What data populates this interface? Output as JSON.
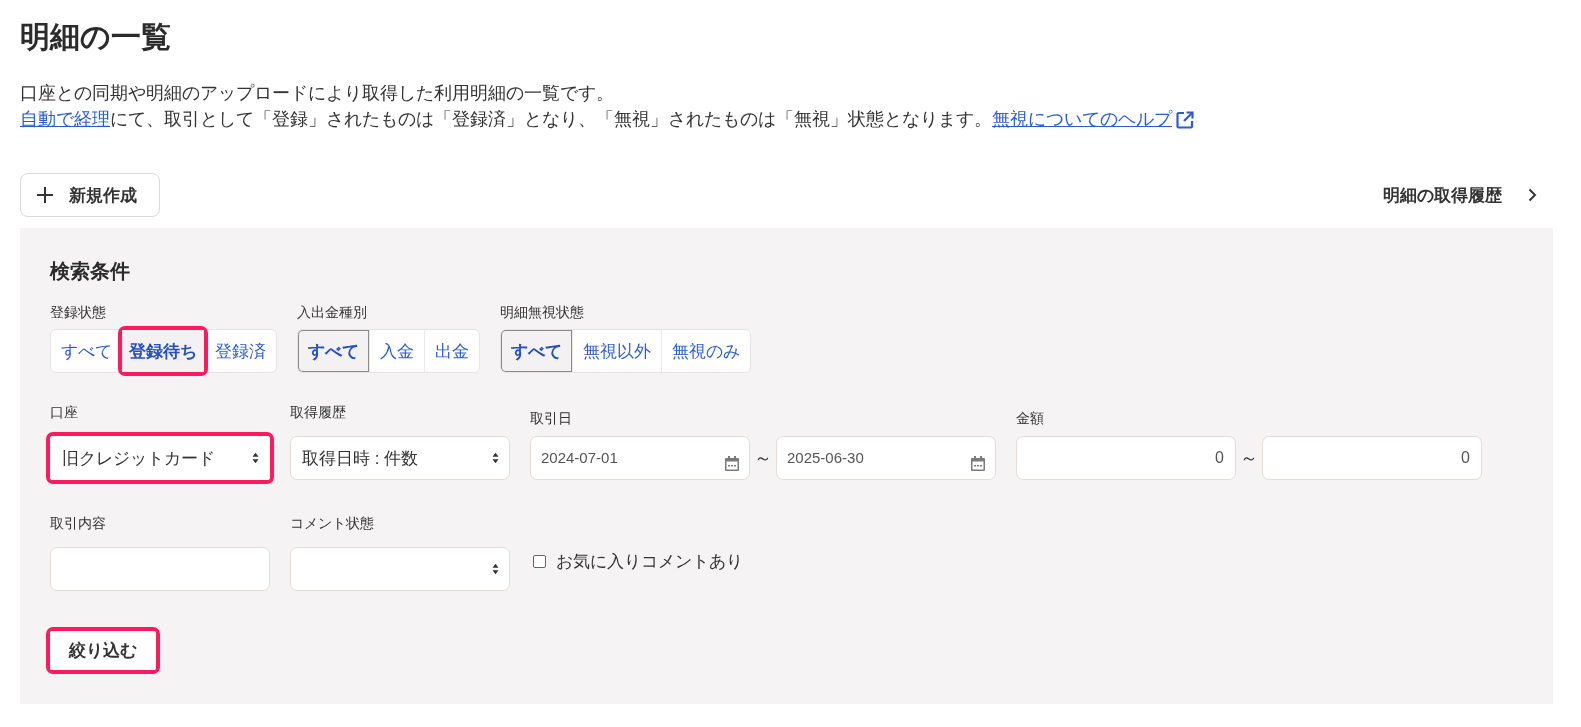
{
  "page": {
    "title": "明細の一覧",
    "description": [
      [
        {
          "kind": "text",
          "text": "口座との同期や明細のアップロードにより取得した利用明細の一覧です。"
        }
      ],
      [
        {
          "kind": "link",
          "text": "自動で経理",
          "external": false
        },
        {
          "kind": "text",
          "text": "にて、取引として「登録」されたものは「登録済」となり、「無視」されたものは「無視」状態となります。"
        },
        {
          "kind": "link",
          "text": "無視についてのヘルプ",
          "external": true
        }
      ]
    ]
  },
  "toolbar": {
    "new_button": "新規作成",
    "history_link": "明細の取得履歴"
  },
  "search": {
    "title": "検索条件",
    "toggle_groups": [
      {
        "label": "登録状態",
        "options": [
          {
            "label": "すべて",
            "selected": false,
            "highlighted": false
          },
          {
            "label": "登録待ち",
            "selected": true,
            "highlighted": true
          },
          {
            "label": "登録済",
            "selected": false,
            "highlighted": false
          }
        ]
      },
      {
        "label": "入出金種別",
        "options": [
          {
            "label": "すべて",
            "selected": true,
            "highlighted": false
          },
          {
            "label": "入金",
            "selected": false,
            "highlighted": false
          },
          {
            "label": "出金",
            "selected": false,
            "highlighted": false
          }
        ]
      },
      {
        "label": "明細無視状態",
        "options": [
          {
            "label": "すべて",
            "selected": true,
            "highlighted": false
          },
          {
            "label": "無視以外",
            "selected": false,
            "highlighted": false
          },
          {
            "label": "無視のみ",
            "selected": false,
            "highlighted": false
          }
        ]
      }
    ],
    "rows": [
      [
        {
          "kind": "select",
          "label": "口座",
          "value": "旧クレジットカード",
          "highlighted": true
        },
        {
          "kind": "select",
          "label": "取得履歴",
          "value": "取得日時 : 件数",
          "highlighted": false
        },
        {
          "kind": "date_range",
          "label": "取引日",
          "from": "2024-07-01",
          "separator": "～",
          "to": "2025-06-30",
          "highlighted": false
        },
        {
          "kind": "amount_range",
          "label": "金額",
          "from": "0",
          "separator": "～",
          "to": "0",
          "highlighted": false
        }
      ],
      [
        {
          "kind": "text",
          "label": "取引内容",
          "highlighted": false
        },
        {
          "kind": "select",
          "label": "コメント状態",
          "highlighted": false
        },
        {
          "kind": "checkbox",
          "label": "お気に入りコメントあり",
          "checked": false,
          "highlighted": false
        }
      ]
    ],
    "submit": {
      "label": "絞り込む",
      "highlighted": true
    }
  }
}
